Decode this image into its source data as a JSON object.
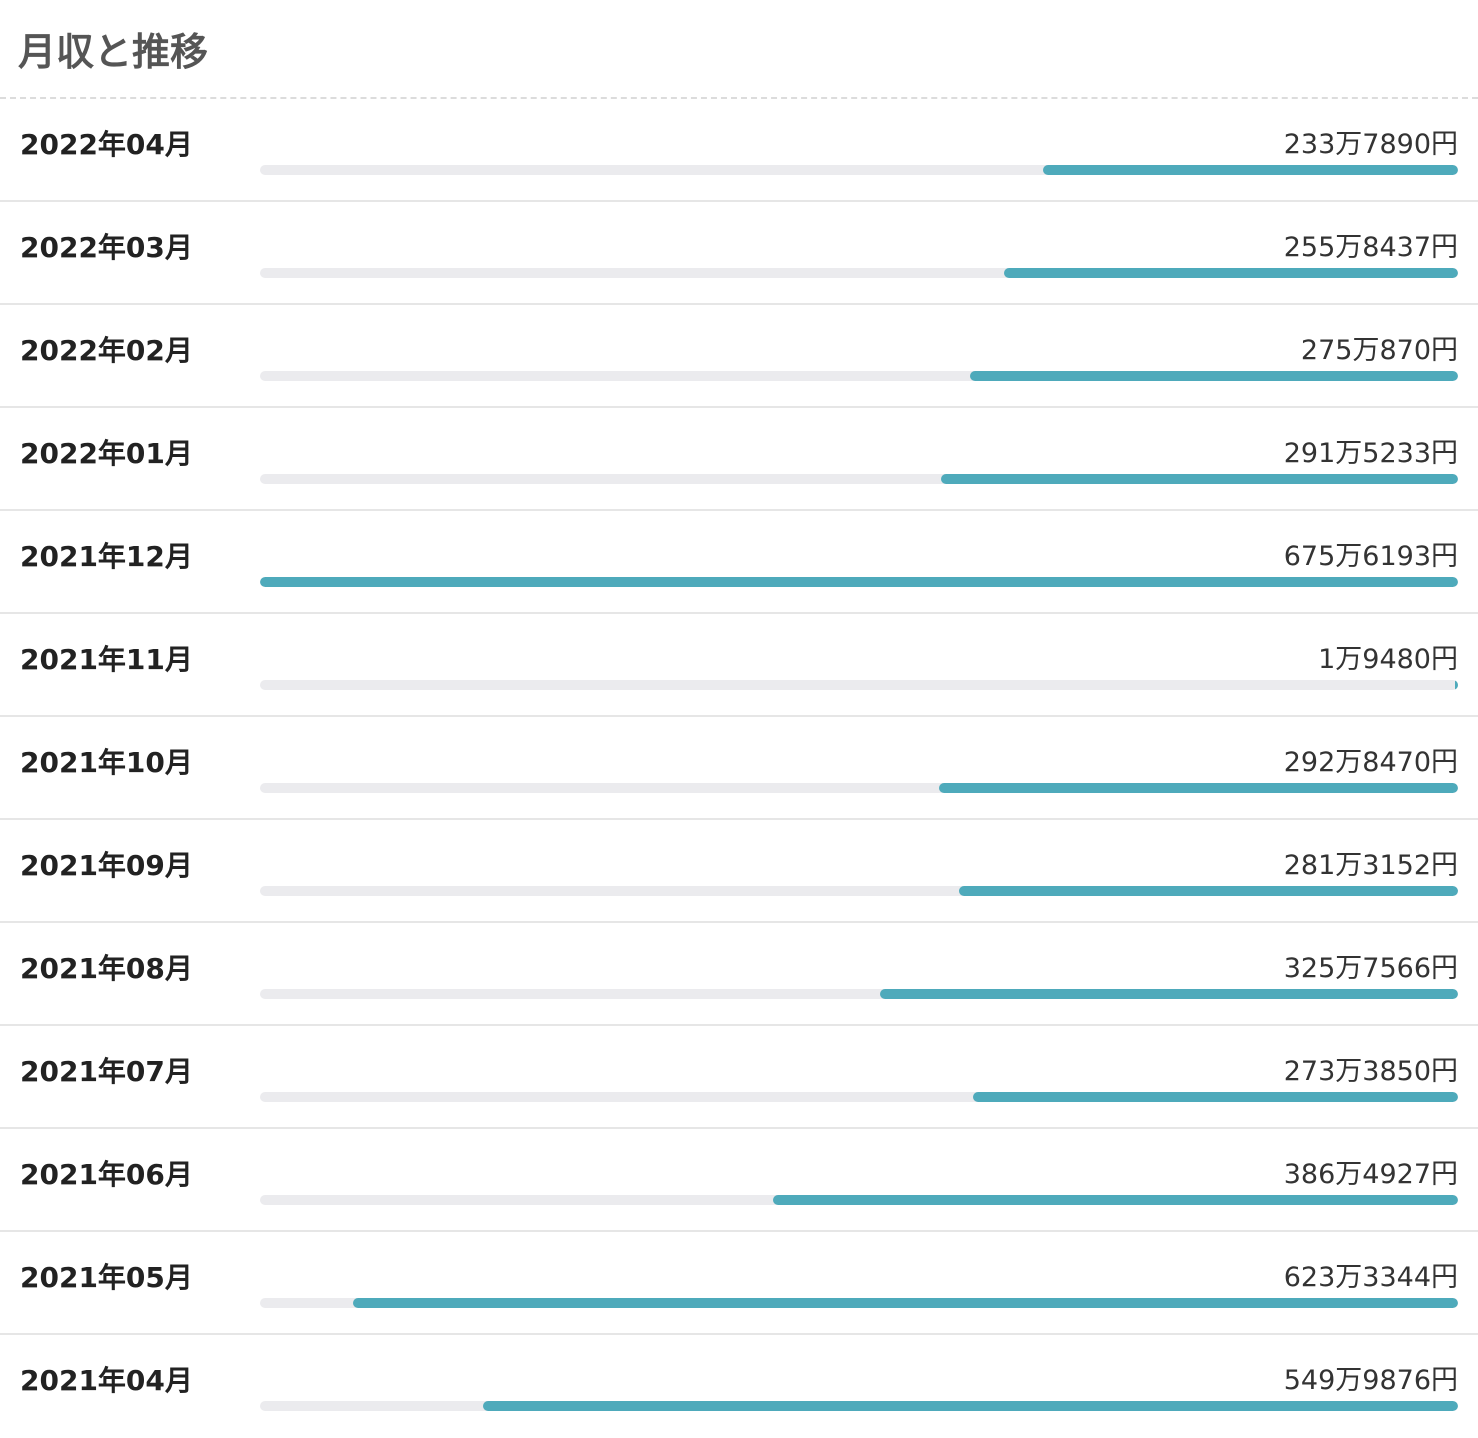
{
  "title": "月収と推移",
  "chart_data": {
    "type": "bar",
    "orientation": "horizontal",
    "unit": "円",
    "xlim": [
      0,
      6756193
    ],
    "fill_color": "#4eaabb",
    "track_color": "#ebebee",
    "grid": false,
    "categories": [
      "2022年04月",
      "2022年03月",
      "2022年02月",
      "2022年01月",
      "2021年12月",
      "2021年11月",
      "2021年10月",
      "2021年09月",
      "2021年08月",
      "2021年07月",
      "2021年06月",
      "2021年05月",
      "2021年04月"
    ],
    "values": [
      2337890,
      2558437,
      2750870,
      2915233,
      6756193,
      19480,
      2928470,
      2813152,
      3257566,
      2733850,
      3864927,
      6233344,
      5499876
    ],
    "value_labels": [
      "233万7890円",
      "255万8437円",
      "275万870円",
      "291万5233円",
      "675万6193円",
      "1万9480円",
      "292万8470円",
      "281万3152円",
      "325万7566円",
      "273万3850円",
      "386万4927円",
      "623万3344円",
      "549万9876円"
    ]
  }
}
